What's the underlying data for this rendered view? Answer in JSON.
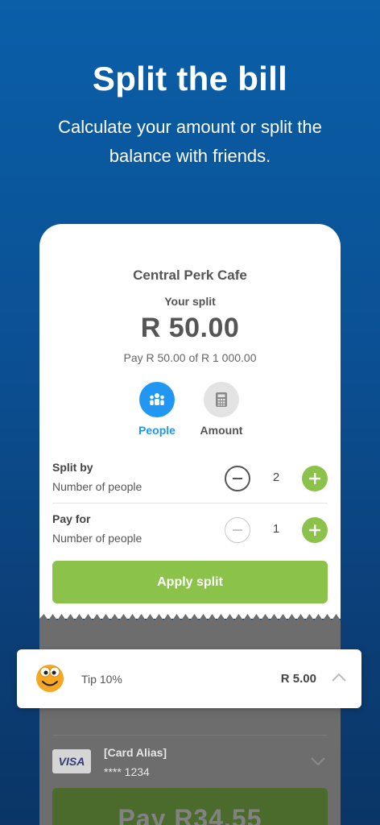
{
  "hero": {
    "title": "Split the bill",
    "subtitle": "Calculate your amount or split the balance with friends."
  },
  "bill": {
    "merchant": "Central Perk Cafe",
    "split_label": "Your split",
    "split_amount": "R 50.00",
    "pay_summary": "Pay R 50.00 of R 1 000.00"
  },
  "modes": {
    "people_label": "People",
    "amount_label": "Amount",
    "selected": "People"
  },
  "split_by": {
    "title": "Split by",
    "subtitle": "Number of people",
    "value": "2"
  },
  "pay_for": {
    "title": "Pay for",
    "subtitle": "Number of people",
    "value": "1"
  },
  "apply_label": "Apply split",
  "tip": {
    "label": "Tip 10%",
    "amount": "R 5.00"
  },
  "payment_card": {
    "brand": "VISA",
    "alias": "[Card Alias]",
    "masked_number": "**** 1234"
  },
  "pay_button_label": "Pay R34.55",
  "colors": {
    "accent_blue": "#2196f3",
    "accent_green": "#8bc34a",
    "bg_blue": "#0b4f92"
  }
}
